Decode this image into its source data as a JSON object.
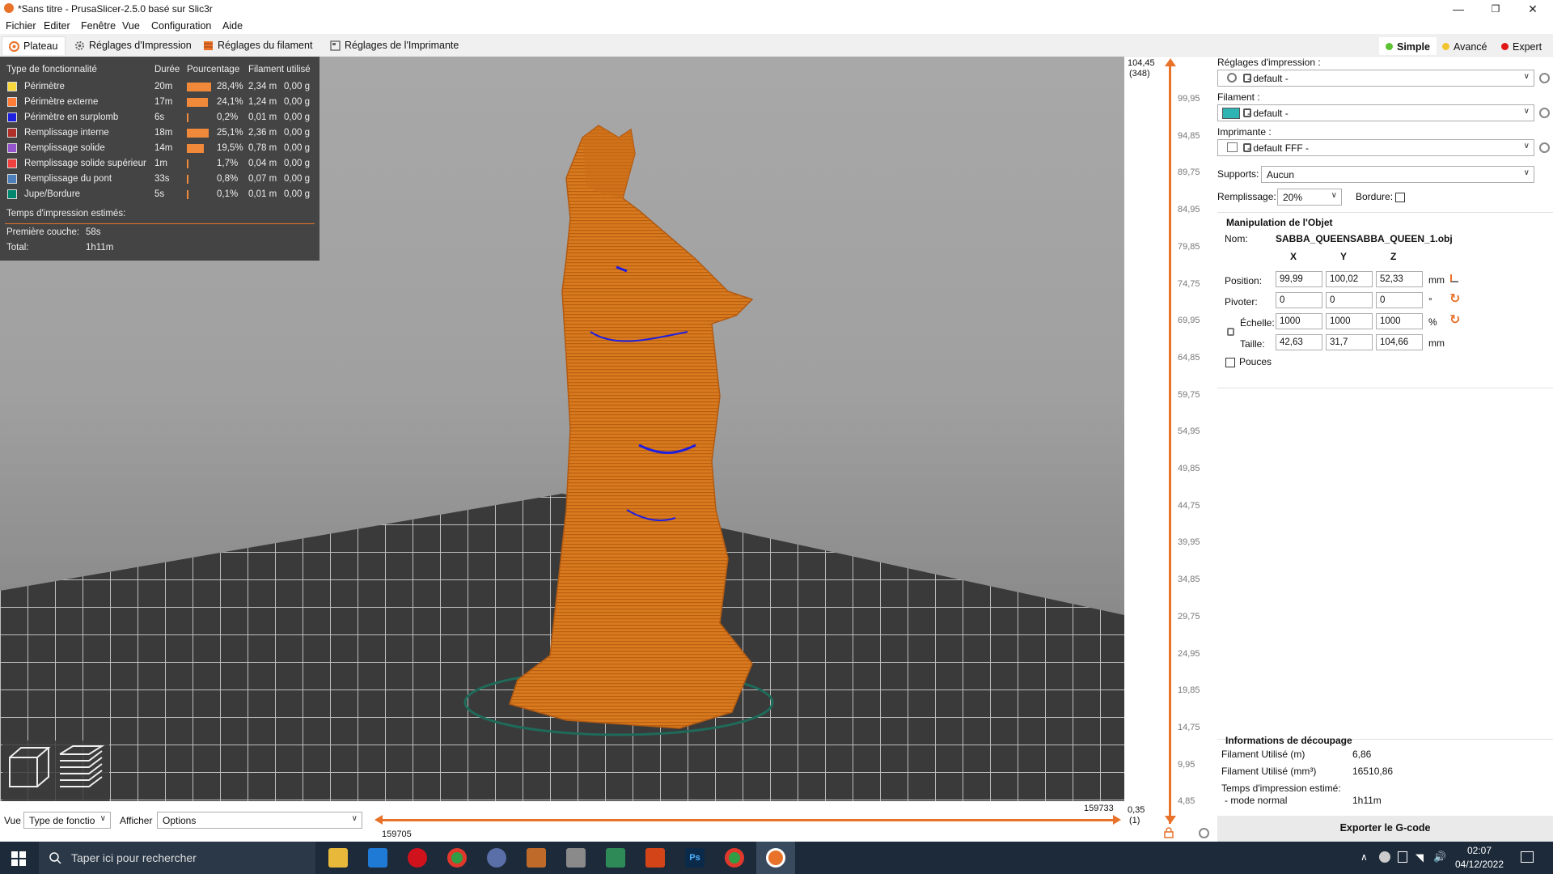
{
  "window": {
    "title": "*Sans titre - PrusaSlicer-2.5.0 basé sur Slic3r",
    "minimize": "—",
    "maximize": "❐",
    "close": "✕"
  },
  "menu": [
    "Fichier",
    "Editer",
    "Fenêtre",
    "Vue",
    "Configuration",
    "Aide"
  ],
  "tabs": [
    {
      "label": "Plateau",
      "active": true
    },
    {
      "label": "Réglages d'Impression",
      "active": false
    },
    {
      "label": "Réglages du filament",
      "active": false
    },
    {
      "label": "Réglages de l'Imprimante",
      "active": false
    }
  ],
  "modes": [
    {
      "label": "Simple",
      "color": "#5cc232",
      "active": true
    },
    {
      "label": "Avancé",
      "color": "#f2c42e",
      "active": false
    },
    {
      "label": "Expert",
      "color": "#e01818",
      "active": false
    }
  ],
  "legend": {
    "headers": [
      "Type de fonctionnalité",
      "Durée",
      "Pourcentage",
      "Filament utilisé"
    ],
    "rows": [
      {
        "name": "Périmètre",
        "color": "#f7d93b",
        "time": "20m",
        "pct": "28,4%",
        "pct_value": 28.4,
        "len": "2,34 m",
        "weight": "0,00 g"
      },
      {
        "name": "Périmètre externe",
        "color": "#ff7d38",
        "time": "17m",
        "pct": "24,1%",
        "pct_value": 24.1,
        "len": "1,24 m",
        "weight": "0,00 g"
      },
      {
        "name": "Périmètre en surplomb",
        "color": "#1f1fdf",
        "time": "6s",
        "pct": "0,2%",
        "pct_value": 0.2,
        "len": "0,01 m",
        "weight": "0,00 g"
      },
      {
        "name": "Remplissage interne",
        "color": "#b03029",
        "time": "18m",
        "pct": "25,1%",
        "pct_value": 25.1,
        "len": "2,36 m",
        "weight": "0,00 g"
      },
      {
        "name": "Remplissage solide",
        "color": "#9654cc",
        "time": "14m",
        "pct": "19,5%",
        "pct_value": 19.5,
        "len": "0,78 m",
        "weight": "0,00 g"
      },
      {
        "name": "Remplissage solide supérieur",
        "color": "#f04040",
        "time": "1m",
        "pct": "1,7%",
        "pct_value": 1.7,
        "len": "0,04 m",
        "weight": "0,00 g"
      },
      {
        "name": "Remplissage du pont",
        "color": "#4d80ba",
        "time": "33s",
        "pct": "0,8%",
        "pct_value": 0.8,
        "len": "0,07 m",
        "weight": "0,00 g"
      },
      {
        "name": "Jupe/Bordure",
        "color": "#00876e",
        "time": "5s",
        "pct": "0,1%",
        "pct_value": 0.1,
        "len": "0,01 m",
        "weight": "0,00 g"
      }
    ],
    "estimated_title": "Temps d'impression estimés:",
    "first_layer_label": "Première couche:",
    "first_layer_value": "58s",
    "total_label": "Total:",
    "total_value": "1h11m"
  },
  "vslider": {
    "top_value": "104,45",
    "top_layer": "(348)",
    "ticks": [
      "99,95",
      "94,85",
      "89,75",
      "84,95",
      "79,85",
      "74,75",
      "69,95",
      "64,85",
      "59,75",
      "54,95",
      "49,85",
      "44,75",
      "39,95",
      "34,85",
      "29,75",
      "24,95",
      "19,85",
      "14,75",
      "9,95",
      "4,85"
    ],
    "bottom_value": "0,35",
    "bottom_layer": "(1)"
  },
  "hslider": {
    "left_value": "159705",
    "right_value": "159733"
  },
  "bottom": {
    "view_label": "Vue",
    "view_value": "Type de fonctio",
    "show_label": "Afficher",
    "show_value": "Options"
  },
  "right_panel": {
    "print_settings_label": "Réglages d'impression :",
    "print_settings_value": "- default -",
    "filament_label": "Filament :",
    "filament_value": "- default -",
    "filament_color": "#2fb4b4",
    "printer_label": "Imprimante :",
    "printer_value": "- default FFF -",
    "supports_label": "Supports:",
    "supports_value": "Aucun",
    "infill_label": "Remplissage:",
    "infill_value": "20%",
    "brim_label": "Bordure:",
    "object_section_title": "Manipulation de l'Objet",
    "name_label": "Nom:",
    "name_value": "SABBA_QUEENSABBA_QUEEN_1.obj",
    "axis_x": "X",
    "axis_y": "Y",
    "axis_z": "Z",
    "position_label": "Position:",
    "position": [
      "99,99",
      "100,02",
      "52,33"
    ],
    "position_unit": "mm",
    "rotate_label": "Pivoter:",
    "rotate": [
      "0",
      "0",
      "0"
    ],
    "rotate_unit": "°",
    "scale_label": "Échelle:",
    "scale": [
      "1000",
      "1000",
      "1000"
    ],
    "scale_unit": "%",
    "size_label": "Taille:",
    "size": [
      "42,63",
      "31,7",
      "104,66"
    ],
    "size_unit": "mm",
    "inches_label": "Pouces",
    "slice_info_title": "Informations de découpage",
    "filament_used_m_label": "Filament Utilisé (m)",
    "filament_used_m": "6,86",
    "filament_used_mm3_label": "Filament Utilisé (mm³)",
    "filament_used_mm3": "16510,86",
    "estimated_time_label": "Temps d'impression estimé:",
    "normal_mode_label": "- mode normal",
    "normal_mode_value": "1h11m",
    "export_label": "Exporter le G-code"
  },
  "taskbar": {
    "search_placeholder": "Taper ici pour rechercher",
    "time": "02:07",
    "date": "04/12/2022"
  }
}
